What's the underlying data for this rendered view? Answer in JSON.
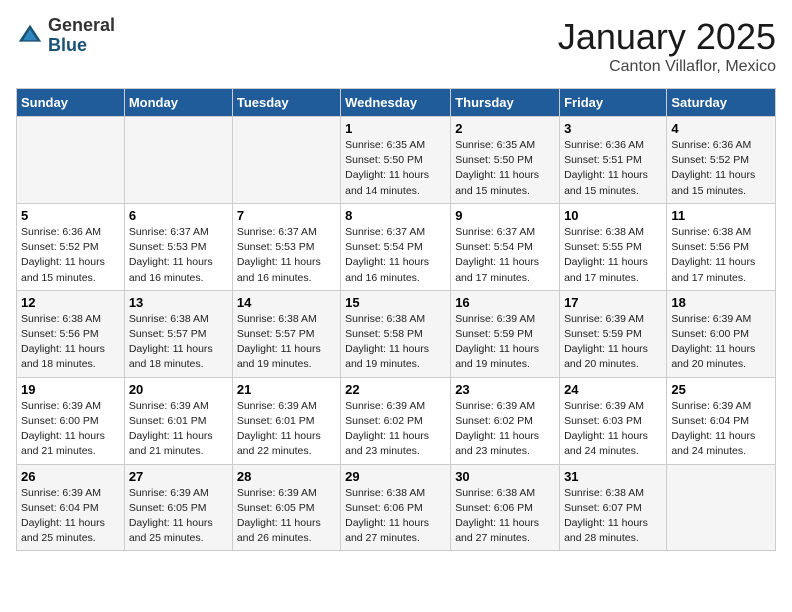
{
  "header": {
    "logo_general": "General",
    "logo_blue": "Blue",
    "title": "January 2025",
    "subtitle": "Canton Villaflor, Mexico"
  },
  "weekdays": [
    "Sunday",
    "Monday",
    "Tuesday",
    "Wednesday",
    "Thursday",
    "Friday",
    "Saturday"
  ],
  "weeks": [
    [
      {
        "day": "",
        "info": ""
      },
      {
        "day": "",
        "info": ""
      },
      {
        "day": "",
        "info": ""
      },
      {
        "day": "1",
        "info": "Sunrise: 6:35 AM\nSunset: 5:50 PM\nDaylight: 11 hours and 14 minutes."
      },
      {
        "day": "2",
        "info": "Sunrise: 6:35 AM\nSunset: 5:50 PM\nDaylight: 11 hours and 15 minutes."
      },
      {
        "day": "3",
        "info": "Sunrise: 6:36 AM\nSunset: 5:51 PM\nDaylight: 11 hours and 15 minutes."
      },
      {
        "day": "4",
        "info": "Sunrise: 6:36 AM\nSunset: 5:52 PM\nDaylight: 11 hours and 15 minutes."
      }
    ],
    [
      {
        "day": "5",
        "info": "Sunrise: 6:36 AM\nSunset: 5:52 PM\nDaylight: 11 hours and 15 minutes."
      },
      {
        "day": "6",
        "info": "Sunrise: 6:37 AM\nSunset: 5:53 PM\nDaylight: 11 hours and 16 minutes."
      },
      {
        "day": "7",
        "info": "Sunrise: 6:37 AM\nSunset: 5:53 PM\nDaylight: 11 hours and 16 minutes."
      },
      {
        "day": "8",
        "info": "Sunrise: 6:37 AM\nSunset: 5:54 PM\nDaylight: 11 hours and 16 minutes."
      },
      {
        "day": "9",
        "info": "Sunrise: 6:37 AM\nSunset: 5:54 PM\nDaylight: 11 hours and 17 minutes."
      },
      {
        "day": "10",
        "info": "Sunrise: 6:38 AM\nSunset: 5:55 PM\nDaylight: 11 hours and 17 minutes."
      },
      {
        "day": "11",
        "info": "Sunrise: 6:38 AM\nSunset: 5:56 PM\nDaylight: 11 hours and 17 minutes."
      }
    ],
    [
      {
        "day": "12",
        "info": "Sunrise: 6:38 AM\nSunset: 5:56 PM\nDaylight: 11 hours and 18 minutes."
      },
      {
        "day": "13",
        "info": "Sunrise: 6:38 AM\nSunset: 5:57 PM\nDaylight: 11 hours and 18 minutes."
      },
      {
        "day": "14",
        "info": "Sunrise: 6:38 AM\nSunset: 5:57 PM\nDaylight: 11 hours and 19 minutes."
      },
      {
        "day": "15",
        "info": "Sunrise: 6:38 AM\nSunset: 5:58 PM\nDaylight: 11 hours and 19 minutes."
      },
      {
        "day": "16",
        "info": "Sunrise: 6:39 AM\nSunset: 5:59 PM\nDaylight: 11 hours and 19 minutes."
      },
      {
        "day": "17",
        "info": "Sunrise: 6:39 AM\nSunset: 5:59 PM\nDaylight: 11 hours and 20 minutes."
      },
      {
        "day": "18",
        "info": "Sunrise: 6:39 AM\nSunset: 6:00 PM\nDaylight: 11 hours and 20 minutes."
      }
    ],
    [
      {
        "day": "19",
        "info": "Sunrise: 6:39 AM\nSunset: 6:00 PM\nDaylight: 11 hours and 21 minutes."
      },
      {
        "day": "20",
        "info": "Sunrise: 6:39 AM\nSunset: 6:01 PM\nDaylight: 11 hours and 21 minutes."
      },
      {
        "day": "21",
        "info": "Sunrise: 6:39 AM\nSunset: 6:01 PM\nDaylight: 11 hours and 22 minutes."
      },
      {
        "day": "22",
        "info": "Sunrise: 6:39 AM\nSunset: 6:02 PM\nDaylight: 11 hours and 23 minutes."
      },
      {
        "day": "23",
        "info": "Sunrise: 6:39 AM\nSunset: 6:02 PM\nDaylight: 11 hours and 23 minutes."
      },
      {
        "day": "24",
        "info": "Sunrise: 6:39 AM\nSunset: 6:03 PM\nDaylight: 11 hours and 24 minutes."
      },
      {
        "day": "25",
        "info": "Sunrise: 6:39 AM\nSunset: 6:04 PM\nDaylight: 11 hours and 24 minutes."
      }
    ],
    [
      {
        "day": "26",
        "info": "Sunrise: 6:39 AM\nSunset: 6:04 PM\nDaylight: 11 hours and 25 minutes."
      },
      {
        "day": "27",
        "info": "Sunrise: 6:39 AM\nSunset: 6:05 PM\nDaylight: 11 hours and 25 minutes."
      },
      {
        "day": "28",
        "info": "Sunrise: 6:39 AM\nSunset: 6:05 PM\nDaylight: 11 hours and 26 minutes."
      },
      {
        "day": "29",
        "info": "Sunrise: 6:38 AM\nSunset: 6:06 PM\nDaylight: 11 hours and 27 minutes."
      },
      {
        "day": "30",
        "info": "Sunrise: 6:38 AM\nSunset: 6:06 PM\nDaylight: 11 hours and 27 minutes."
      },
      {
        "day": "31",
        "info": "Sunrise: 6:38 AM\nSunset: 6:07 PM\nDaylight: 11 hours and 28 minutes."
      },
      {
        "day": "",
        "info": ""
      }
    ]
  ]
}
